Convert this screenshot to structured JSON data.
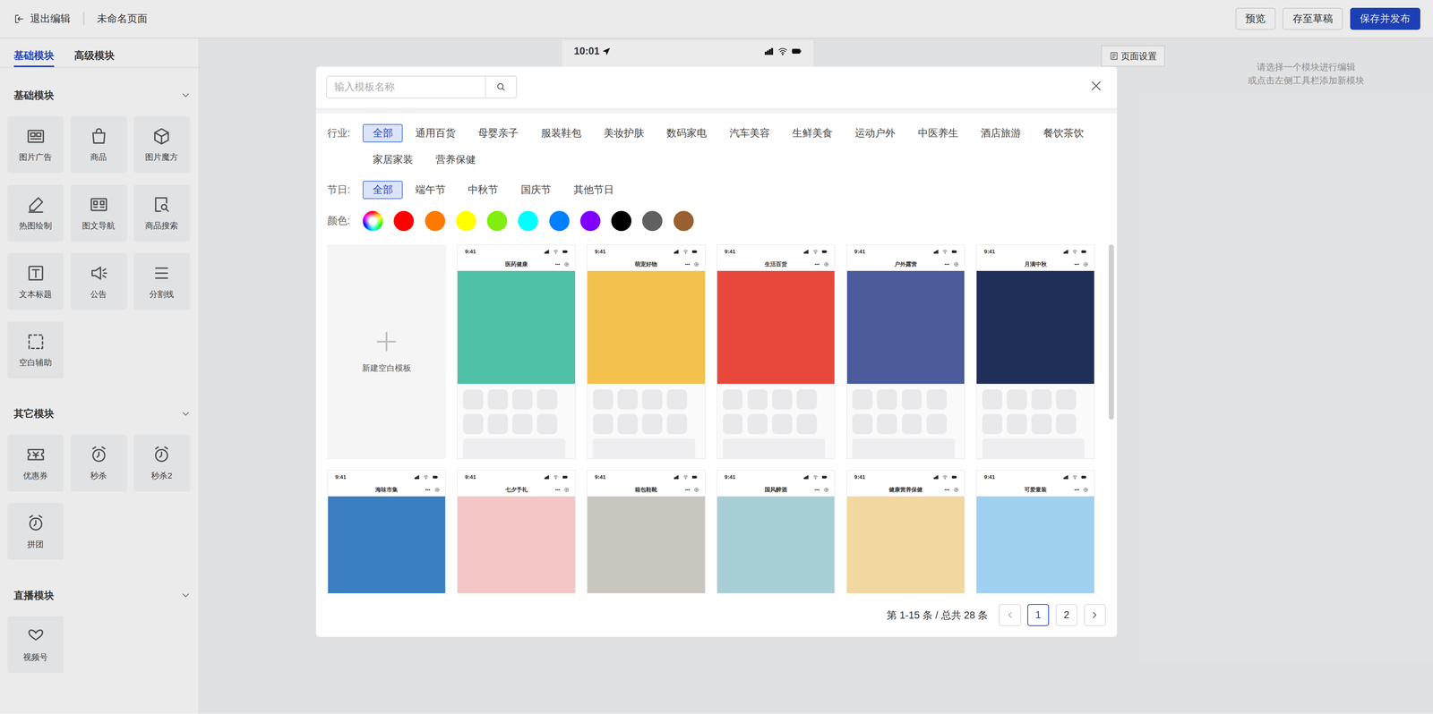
{
  "topbar": {
    "exit": "退出编辑",
    "page_title": "未命名页面",
    "buttons": [
      {
        "label": "预览",
        "primary": false
      },
      {
        "label": "存至草稿",
        "primary": false
      },
      {
        "label": "保存并发布",
        "primary": true
      }
    ]
  },
  "sidebar": {
    "tabs": [
      {
        "label": "基础模块",
        "selected": true
      },
      {
        "label": "高级模块",
        "selected": false
      }
    ],
    "sections": [
      {
        "title": "基础模块",
        "expanded": true,
        "items": [
          "图片广告",
          "商品",
          "图片魔方",
          "热图绘制",
          "图文导航",
          "商品搜索",
          "文本标题",
          "公告",
          "分割线",
          "空白辅助"
        ]
      },
      {
        "title": "其它模块",
        "expanded": true,
        "items": [
          "优惠券",
          "秒杀",
          "秒杀2",
          "拼团"
        ]
      },
      {
        "title": "直播模块",
        "expanded": true,
        "items": [
          "视频号"
        ]
      }
    ]
  },
  "preview": {
    "time": "10:01"
  },
  "page_settings": "页面设置",
  "hint": [
    "请选择一个模块进行编辑",
    "或点击左侧工具栏添加新模块"
  ],
  "modal": {
    "search": {
      "placeholder": "输入模板名称"
    },
    "filters": [
      {
        "label": "行业:",
        "options": [
          {
            "label": "全部",
            "selected": true
          },
          {
            "label": "通用百货",
            "selected": false
          },
          {
            "label": "母婴亲子",
            "selected": false
          },
          {
            "label": "服装鞋包",
            "selected": false
          },
          {
            "label": "美妆护肤",
            "selected": false
          },
          {
            "label": "数码家电",
            "selected": false
          },
          {
            "label": "汽车美容",
            "selected": false
          },
          {
            "label": "生鲜美食",
            "selected": false
          },
          {
            "label": "运动户外",
            "selected": false
          },
          {
            "label": "中医养生",
            "selected": false
          },
          {
            "label": "酒店旅游",
            "selected": false
          },
          {
            "label": "餐饮茶饮",
            "selected": false
          },
          {
            "label": "家居家装",
            "selected": false
          },
          {
            "label": "营养保健",
            "selected": false
          }
        ]
      },
      {
        "label": "节日:",
        "options": [
          {
            "label": "全部",
            "selected": true
          },
          {
            "label": "端午节",
            "selected": false
          },
          {
            "label": "中秋节",
            "selected": false
          },
          {
            "label": "国庆节",
            "selected": false
          },
          {
            "label": "其他节日",
            "selected": false
          }
        ]
      }
    ],
    "colors": {
      "label": "颜色:",
      "swatches": [
        {
          "kind": "rainbow",
          "color": "#ffffff"
        },
        {
          "kind": "solid",
          "color": "#ff0000"
        },
        {
          "kind": "solid",
          "color": "#ff7a00"
        },
        {
          "kind": "solid",
          "color": "#ffff00"
        },
        {
          "kind": "solid",
          "color": "#80ee10"
        },
        {
          "kind": "solid",
          "color": "#00ffff"
        },
        {
          "kind": "solid",
          "color": "#0080ff"
        },
        {
          "kind": "solid",
          "color": "#8000ff"
        },
        {
          "kind": "solid",
          "color": "#000000"
        },
        {
          "kind": "solid",
          "color": "#606060"
        },
        {
          "kind": "solid",
          "color": "#9a6030"
        }
      ]
    },
    "new_template": "新建空白模板",
    "templates": [
      {
        "title": "医药健康",
        "time": "9:41",
        "color": "#4fc1a6"
      },
      {
        "title": "萌宠好物",
        "time": "9:41",
        "color": "#f2c14e"
      },
      {
        "title": "生活百货",
        "time": "9:41",
        "color": "#e8483b"
      },
      {
        "title": "户外露营",
        "time": "9:41",
        "color": "#4a5a9a"
      },
      {
        "title": "月满中秋",
        "time": "9:41",
        "color": "#1f2f5a"
      },
      {
        "title": "海味市集",
        "time": "9:41",
        "color": "#3a7fc1"
      },
      {
        "title": "七夕予礼",
        "time": "9:41",
        "color": "#f4c6c6"
      },
      {
        "title": "箱包鞋靴",
        "time": "9:41",
        "color": "#c9c6c0"
      },
      {
        "title": "国风醉酒",
        "time": "9:41",
        "color": "#a9cfd6"
      },
      {
        "title": "健康营养保健",
        "time": "9:41",
        "color": "#f2d7a0"
      },
      {
        "title": "可爱童装",
        "time": "9:41",
        "color": "#9fd0f0"
      }
    ],
    "pagination": {
      "summary": "第 1-15 条 / 总共 28 条",
      "pages": [
        {
          "label": "1",
          "selected": true
        },
        {
          "label": "2",
          "selected": false
        }
      ]
    }
  }
}
